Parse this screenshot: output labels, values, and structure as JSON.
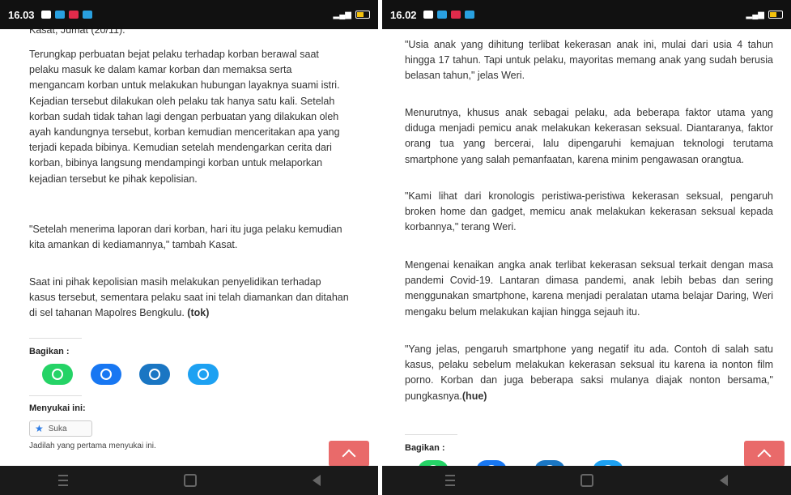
{
  "colors": {
    "whatsapp": "#25d366",
    "facebook": "#1877f2",
    "telegram": "#1a76c3",
    "twitter": "#1da1f2",
    "back_to_top": "#e96a6a",
    "like_star": "#2c7be5"
  },
  "left": {
    "status": {
      "time": "16.03"
    },
    "cut_line": "Kasat, Jumat (20/11).",
    "paragraphs": [
      "Terungkap perbuatan bejat pelaku terhadap korban berawal saat pelaku masuk ke dalam kamar korban dan memaksa serta mengancam korban untuk melakukan hubungan layaknya suami istri. Kejadian tersebut dilakukan oleh pelaku tak hanya satu kali. Setelah korban sudah tidak tahan lagi dengan perbuatan yang dilakukan oleh ayah kandungnya tersebut, korban kemudian menceritakan apa yang terjadi kepada bibinya. Kemudian setelah mendengarkan cerita dari korban, bibinya langsung mendampingi korban untuk melaporkan kejadian tersebut ke pihak kepolisian.",
      "\"Setelah menerima laporan dari korban, hari itu juga pelaku kemudian kita amankan di kediamannya,\" tambah Kasat."
    ],
    "para3": "Saat ini pihak kepolisian masih melakukan penyelidikan terhadap kasus tersebut, sementara pelaku saat ini telah diamankan dan ditahan di sel tahanan Mapolres Bengkulu.",
    "para3_bold": "(tok)",
    "share_heading": "Bagikan :",
    "like_heading": "Menyukai ini:",
    "like_button": "Suka",
    "first_like": "Jadilah yang pertama menyukai ini."
  },
  "right": {
    "status": {
      "time": "16.02"
    },
    "paragraphs": [
      "\"Usia anak yang dihitung terlibat kekerasan anak ini, mulai dari usia 4 tahun hingga 17 tahun. Tapi untuk pelaku, mayoritas memang anak yang sudah berusia belasan tahun,\" jelas Weri.",
      "Menurutnya, khusus anak sebagai pelaku, ada beberapa faktor utama yang diduga menjadi pemicu anak melakukan kekerasan seksual. Diantaranya, faktor orang tua yang bercerai, lalu dipengaruhi kemajuan teknologi terutama smartphone yang salah pemanfaatan, karena minim pengawasan orangtua.",
      "\"Kami lihat dari kronologis peristiwa-peristiwa kekerasan seksual, pengaruh broken home dan gadget, memicu anak melakukan kekerasan seksual kepada korbannya,\" terang Weri.",
      "Mengenai kenaikan angka anak terlibat kekerasan seksual terkait dengan masa pandemi Covid-19. Lantaran dimasa pandemi, anak lebih bebas dan sering menggunakan smartphone, karena menjadi peralatan utama belajar Daring, Weri mengaku belum melakukan kajian hingga sejauh itu."
    ],
    "para5": "\"Yang jelas,  pengaruh smartphone yang negatif itu ada. Contoh di salah satu kasus, pelaku sebelum melakukan kekerasan seksual itu karena ia nonton film porno. Korban dan juga beberapa saksi mulanya diajak nonton bersama,\" pungkasnya.",
    "para5_bold": "(hue)",
    "share_heading": "Bagikan :"
  }
}
